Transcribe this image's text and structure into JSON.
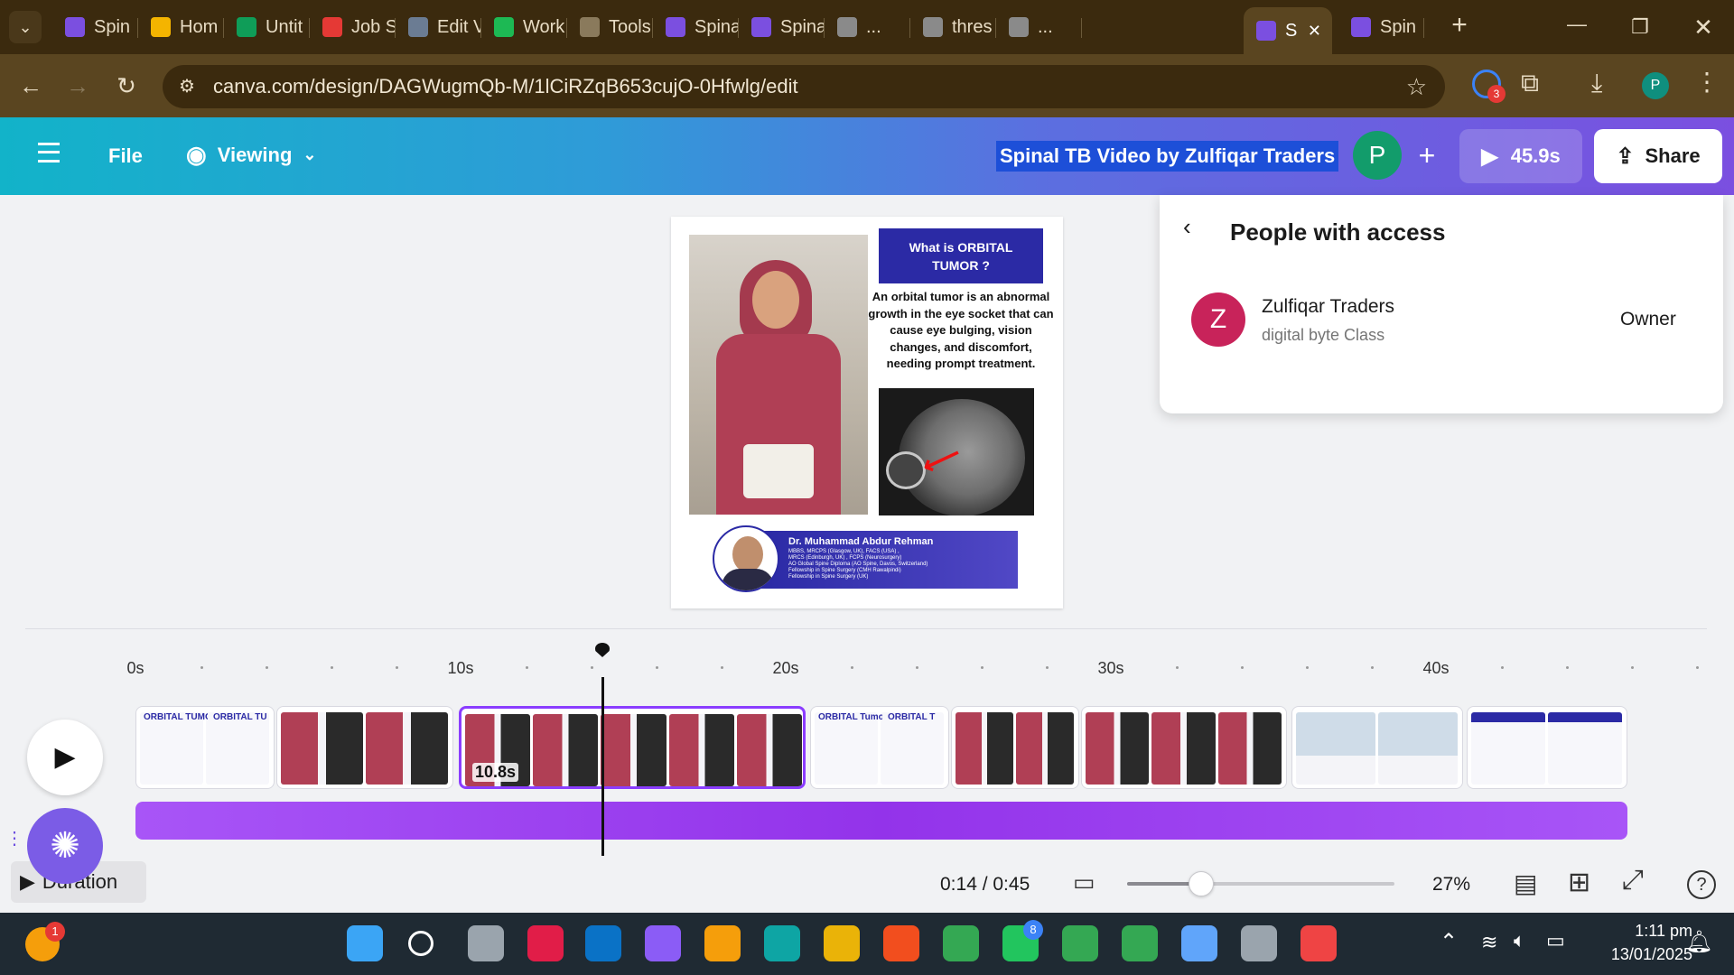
{
  "browser": {
    "tabs": [
      {
        "label": "Spin",
        "color": "#7b4fe0"
      },
      {
        "label": "Hom",
        "color": "#f4b400"
      },
      {
        "label": "Untit",
        "color": "#0f9d58"
      },
      {
        "label": "Job S",
        "color": "#e53935"
      },
      {
        "label": "Edit V",
        "color": "#6b7c93"
      },
      {
        "label": "Work",
        "color": "#1db954"
      },
      {
        "label": "Tools",
        "color": "#8a7a5c"
      },
      {
        "label": "Spina",
        "color": "#7b4fe0"
      },
      {
        "label": "Spina",
        "color": "#7b4fe0"
      },
      {
        "label": "...",
        "color": "#8a8a8a"
      },
      {
        "label": "thres",
        "color": "#8a8a8a"
      },
      {
        "label": "...",
        "color": "#8a8a8a"
      },
      {
        "label": "S",
        "color": "#7b4fe0"
      },
      {
        "label": "Spin",
        "color": "#7b4fe0"
      }
    ],
    "url": "canva.com/design/DAGWugmQb-M/1lCiRZqB653cujO-0Hfwlg/edit",
    "extension_badge": "3",
    "profile_initial": "P"
  },
  "canva": {
    "menu": "File",
    "mode": "Viewing",
    "title": "Spinal TB Video by Zulfiqar Traders",
    "avatar": "P",
    "duration": "45.9s",
    "share": "Share"
  },
  "poster": {
    "heading": "What is ORBITAL TUMOR ?",
    "body": "An orbital tumor is an abnormal growth in the eye socket that can cause eye bulging, vision changes, and discomfort, needing prompt treatment.",
    "doctor_name": "Dr. Muhammad Abdur Rehman",
    "doctor_lines": [
      "MBBS, MRCPS (Glasgow, UK), FACS (USA) ,",
      "MRCS (Edinburgh, UK) , FCPS (Neurosurgery)",
      "AO Global Spine Diploma (AO Spine, Davos, Switzerland)",
      "Fellowship in Spine Surgery (CMH Rawalpindi)",
      "Fellowship in Spine Surgery (UK)"
    ]
  },
  "access_panel": {
    "title": "People with access",
    "person_initial": "Z",
    "person_name": "Zulfiqar Traders",
    "person_subtitle": "digital byte Class",
    "role": "Owner"
  },
  "timeline": {
    "ruler": [
      "0s",
      "10s",
      "20s",
      "30s",
      "40s"
    ],
    "selected_clip_duration": "10.8s",
    "time": "0:14 / 0:45",
    "zoom": "27%",
    "duration_label": "Duration",
    "clip_titles": [
      "ORBITAL TUMOR",
      "ORBITAL TU",
      "ORBITAL Tumor",
      "ORBITAL T"
    ],
    "zoom_level": 0.27
  },
  "taskbar": {
    "time": "1:11 pm",
    "date": "13/01/2025",
    "whatsapp_badge": "8",
    "notif_badge": "1"
  }
}
